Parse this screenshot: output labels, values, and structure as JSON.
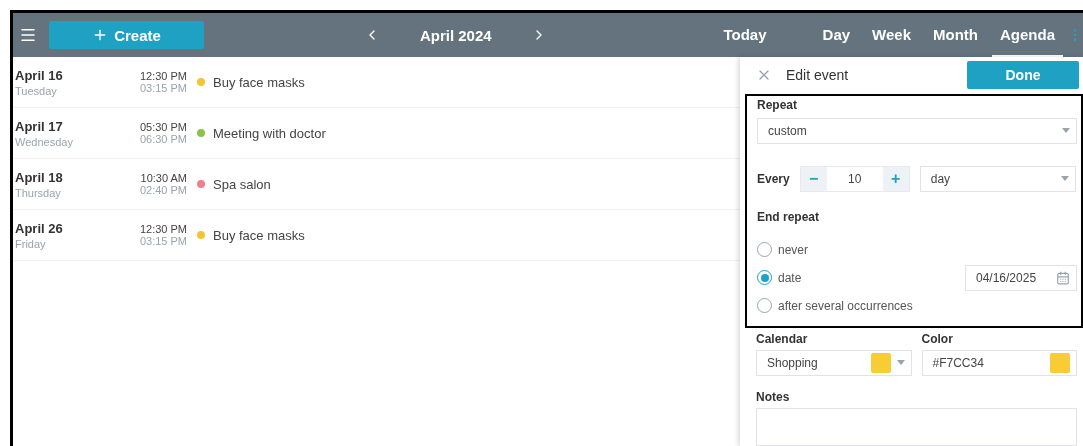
{
  "toolbar": {
    "create_label": "Create",
    "period": "April 2024",
    "today_label": "Today",
    "views": [
      {
        "label": "Day",
        "selected": false
      },
      {
        "label": "Week",
        "selected": false
      },
      {
        "label": "Month",
        "selected": false
      },
      {
        "label": "Agenda",
        "selected": true
      }
    ]
  },
  "agenda": [
    {
      "date": "April 16",
      "weekday": "Tuesday",
      "start": "12:30 PM",
      "end": "03:15 PM",
      "title": "Buy face masks",
      "color": "#f5c531"
    },
    {
      "date": "April 17",
      "weekday": "Wednesday",
      "start": "05:30 PM",
      "end": "06:30 PM",
      "title": "Meeting with doctor",
      "color": "#8bc34a"
    },
    {
      "date": "April 18",
      "weekday": "Thursday",
      "start": "10:30 AM",
      "end": "02:40 PM",
      "title": "Spa salon",
      "color": "#ef7f8c"
    },
    {
      "date": "April 26",
      "weekday": "Friday",
      "start": "12:30 PM",
      "end": "03:15 PM",
      "title": "Buy face masks",
      "color": "#f5c531"
    }
  ],
  "editor": {
    "title": "Edit event",
    "done_label": "Done",
    "repeat_label": "Repeat",
    "repeat_value": "custom",
    "every_label": "Every",
    "minus": "−",
    "count": "10",
    "plus": "+",
    "unit": "day",
    "end_label": "End repeat",
    "end_options": [
      {
        "label": "never",
        "selected": false
      },
      {
        "label": "date",
        "selected": true
      },
      {
        "label": "after several occurrences",
        "selected": false
      }
    ],
    "end_date": "04/16/2025",
    "calendar_label": "Calendar",
    "calendar_value": "Shopping",
    "calendar_swatch": {
      "color": "#f7cc34"
    },
    "color_label": "Color",
    "color_value": "#F7CC34",
    "notes_label": "Notes"
  }
}
